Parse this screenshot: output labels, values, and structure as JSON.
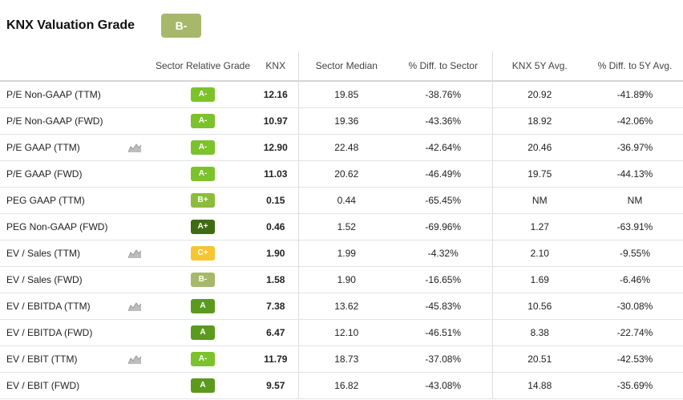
{
  "page": {
    "title": "KNX Valuation Grade",
    "overall_grade": "B-",
    "overall_grade_color": "#a7b86a"
  },
  "columns": [
    "",
    "Sector Relative Grade",
    "KNX",
    "Sector Median",
    "% Diff. to Sector",
    "KNX 5Y Avg.",
    "% Diff. to 5Y Avg."
  ],
  "grade_colors": {
    "A+": "#3f6b12",
    "A": "#5b9a1e",
    "A-": "#7cc22a",
    "B+": "#8bbd3a",
    "B-": "#a7b86a",
    "C+": "#f7c531"
  },
  "rows": [
    {
      "metric": "P/E Non-GAAP (TTM)",
      "icon": "",
      "grade": "A-",
      "knx": "12.16",
      "sector_median": "19.85",
      "diff_sector": "-38.76%",
      "avg5y": "20.92",
      "diff_5y": "-41.89%"
    },
    {
      "metric": "P/E Non-GAAP (FWD)",
      "icon": "",
      "grade": "A-",
      "knx": "10.97",
      "sector_median": "19.36",
      "diff_sector": "-43.36%",
      "avg5y": "18.92",
      "diff_5y": "-42.06%"
    },
    {
      "metric": "P/E GAAP (TTM)",
      "icon": "mini-chart-icon",
      "grade": "A-",
      "knx": "12.90",
      "sector_median": "22.48",
      "diff_sector": "-42.64%",
      "avg5y": "20.46",
      "diff_5y": "-36.97%"
    },
    {
      "metric": "P/E GAAP (FWD)",
      "icon": "",
      "grade": "A-",
      "knx": "11.03",
      "sector_median": "20.62",
      "diff_sector": "-46.49%",
      "avg5y": "19.75",
      "diff_5y": "-44.13%"
    },
    {
      "metric": "PEG GAAP (TTM)",
      "icon": "",
      "grade": "B+",
      "knx": "0.15",
      "sector_median": "0.44",
      "diff_sector": "-65.45%",
      "avg5y": "NM",
      "diff_5y": "NM"
    },
    {
      "metric": "PEG Non-GAAP (FWD)",
      "icon": "",
      "grade": "A+",
      "knx": "0.46",
      "sector_median": "1.52",
      "diff_sector": "-69.96%",
      "avg5y": "1.27",
      "diff_5y": "-63.91%"
    },
    {
      "metric": "EV / Sales (TTM)",
      "icon": "mini-chart-icon",
      "grade": "C+",
      "knx": "1.90",
      "sector_median": "1.99",
      "diff_sector": "-4.32%",
      "avg5y": "2.10",
      "diff_5y": "-9.55%"
    },
    {
      "metric": "EV / Sales (FWD)",
      "icon": "",
      "grade": "B-",
      "knx": "1.58",
      "sector_median": "1.90",
      "diff_sector": "-16.65%",
      "avg5y": "1.69",
      "diff_5y": "-6.46%"
    },
    {
      "metric": "EV / EBITDA (TTM)",
      "icon": "mini-chart-icon",
      "grade": "A",
      "knx": "7.38",
      "sector_median": "13.62",
      "diff_sector": "-45.83%",
      "avg5y": "10.56",
      "diff_5y": "-30.08%"
    },
    {
      "metric": "EV / EBITDA (FWD)",
      "icon": "",
      "grade": "A",
      "knx": "6.47",
      "sector_median": "12.10",
      "diff_sector": "-46.51%",
      "avg5y": "8.38",
      "diff_5y": "-22.74%"
    },
    {
      "metric": "EV / EBIT (TTM)",
      "icon": "mini-chart-icon",
      "grade": "A-",
      "knx": "11.79",
      "sector_median": "18.73",
      "diff_sector": "-37.08%",
      "avg5y": "20.51",
      "diff_5y": "-42.53%"
    },
    {
      "metric": "EV / EBIT (FWD)",
      "icon": "",
      "grade": "A",
      "knx": "9.57",
      "sector_median": "16.82",
      "diff_sector": "-43.08%",
      "avg5y": "14.88",
      "diff_5y": "-35.69%"
    }
  ]
}
